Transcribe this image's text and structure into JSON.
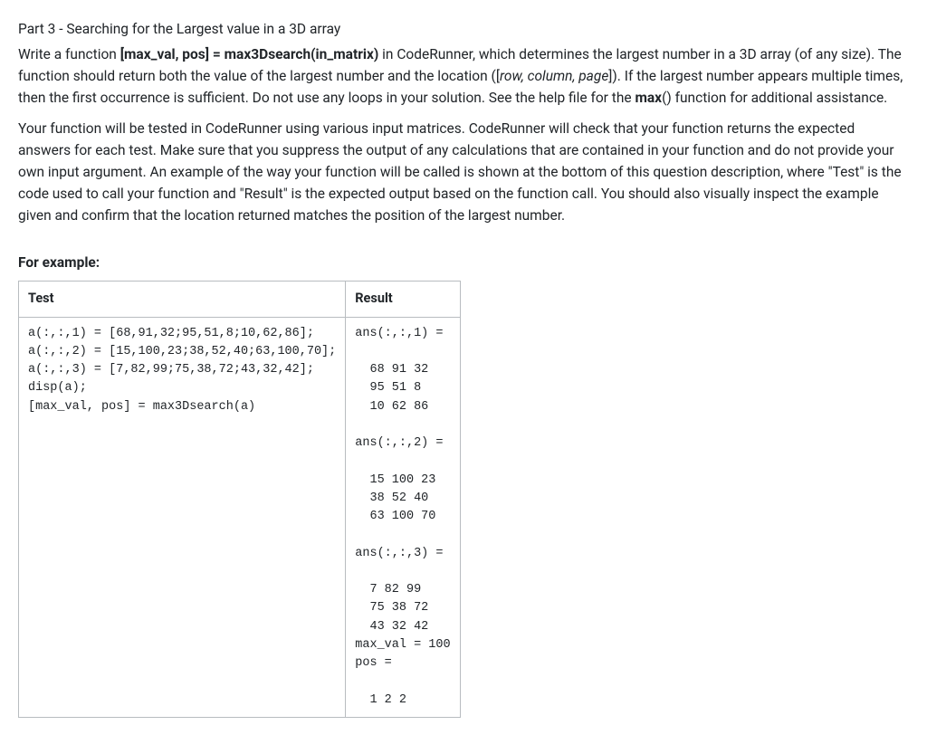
{
  "title": "Part 3 - Searching for the Largest value in a 3D array",
  "intro": {
    "prefix": "Write a function ",
    "signature": "[max_val, pos] = max3Dsearch(in_matrix)",
    "mid1": " in CodeRunner, which determines the largest number in a 3D array (of any size).  The function should return both the value of the largest number and the location ([",
    "italic_loc": "row, column, page",
    "mid2": "]).  If the largest number appears multiple times, then the first occurrence is sufficient.  Do not use any loops in your solution.  See the help file for the ",
    "max_bold": "max",
    "mid3": "() function for additional assistance."
  },
  "para2": "Your function will be tested in CodeRunner using various input matrices. CodeRunner will check that your function returns the expected answers for each test.  Make sure that you suppress the output of any calculations that are contained in your function and do not provide your own input argument.  An example of the way your function will be called is shown at the bottom of this question description, where \"Test\" is the code used to call your function and \"Result\" is the expected output based on the function call.  You should also visually inspect the example given and confirm that the location returned matches the position of the largest number.",
  "example_label": "For example:",
  "table": {
    "headers": {
      "test": "Test",
      "result": "Result"
    },
    "test_code": "a(:,:,1) = [68,91,32;95,51,8;10,62,86];\na(:,:,2) = [15,100,23;38,52,40;63,100,70];\na(:,:,3) = [7,82,99;75,38,72;43,32,42];\ndisp(a);\n[max_val, pos] = max3Dsearch(a)",
    "result_text": "ans(:,:,1) =\n\n  68 91 32\n  95 51 8\n  10 62 86\n\nans(:,:,2) =\n\n  15 100 23\n  38 52 40\n  63 100 70\n\nans(:,:,3) =\n\n  7 82 99\n  75 38 72\n  43 32 42\nmax_val = 100\npos =\n\n  1 2 2"
  }
}
